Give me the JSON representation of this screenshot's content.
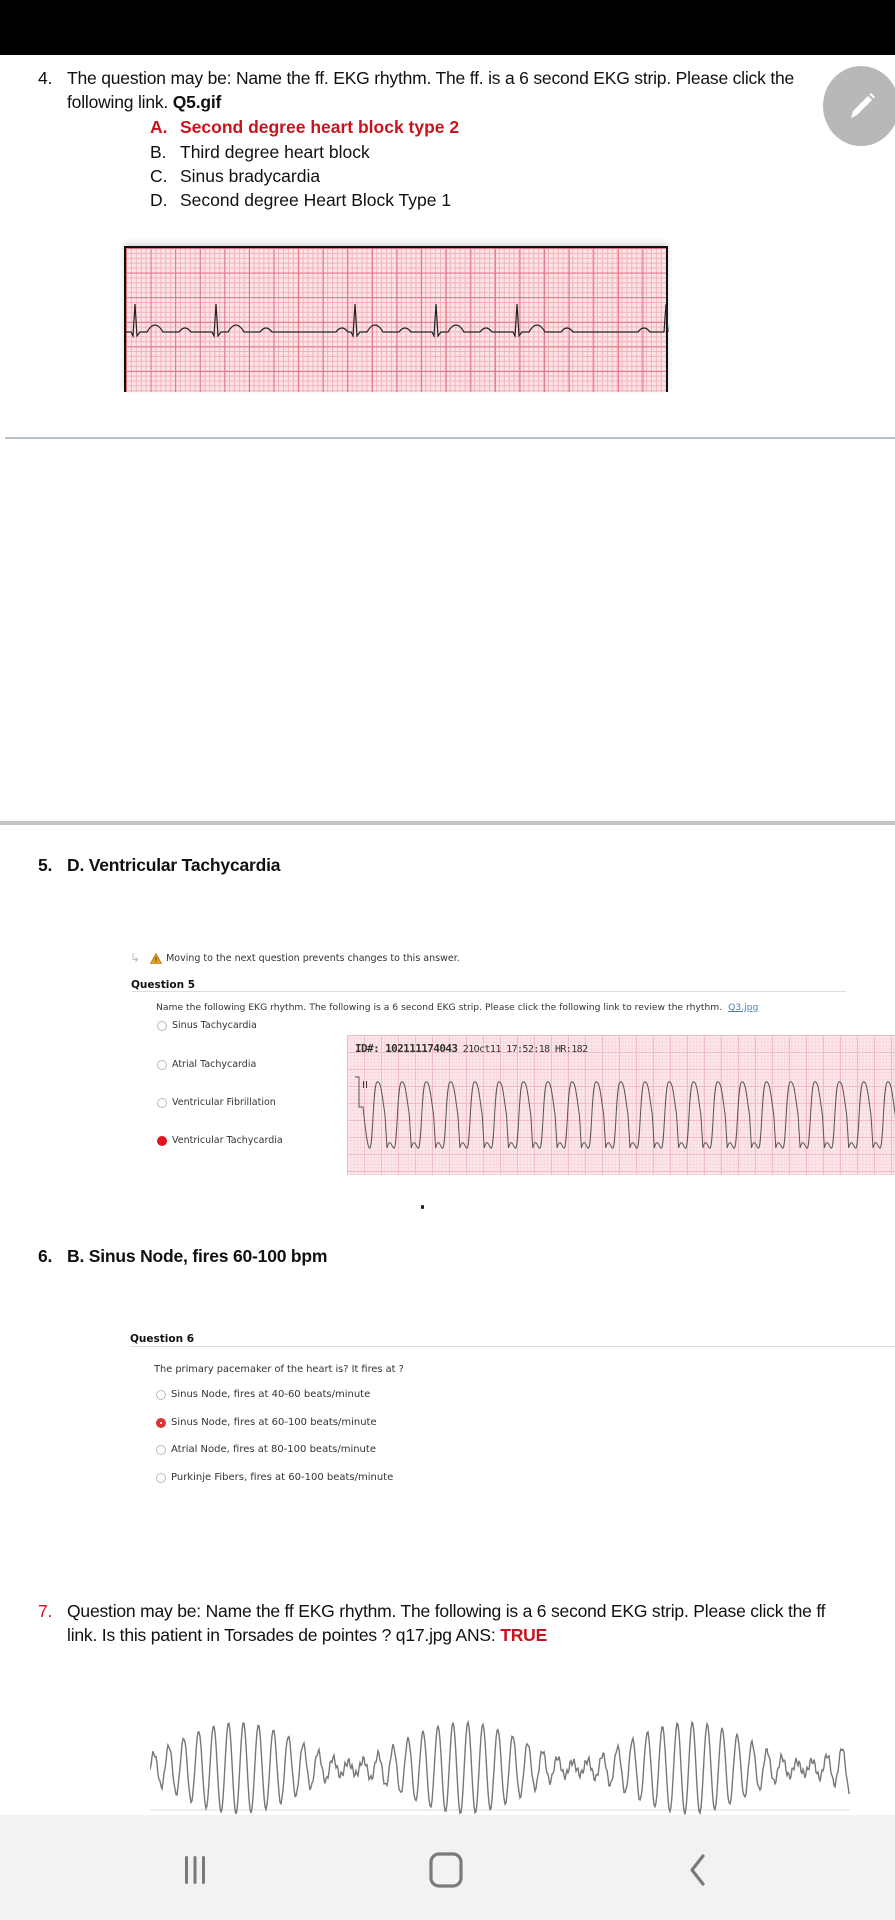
{
  "q4": {
    "number": "4.",
    "text_line1": "The question may be: Name the ff. EKG rhythm. The ff. is a 6 second EKG strip. Please click the",
    "text_line2_prefix": "following link. ",
    "link_file": "Q5.gif",
    "options": [
      {
        "letter": "A.",
        "label": "Second degree heart block type 2",
        "highlighted": true,
        "color": "#c8141c"
      },
      {
        "letter": "B.",
        "label": "Third degree heart block",
        "highlighted": false
      },
      {
        "letter": "C.",
        "label": "Sinus bradycardia",
        "highlighted": false
      },
      {
        "letter": "D.",
        "label": "Second degree Heart Block Type 1",
        "highlighted": false
      }
    ],
    "ekg_image": "second-degree-heart-block-strip"
  },
  "edit_button": {
    "icon": "pencil-icon",
    "color": "#b8b8b8"
  },
  "q5": {
    "number": "5.",
    "answer": "D. Ventricular Tachycardia",
    "screenshot": {
      "warning": "Moving to the next question prevents changes to this answer.",
      "title": "Question 5",
      "prompt": "Name the following EKG rhythm. The following is a 6 second EKG strip. Please click the following link to review the rhythm.",
      "link": "Q3.jpg",
      "choices": [
        {
          "label": "Sinus Tachycardia",
          "selected": false
        },
        {
          "label": "Atrial Tachycardia",
          "selected": false
        },
        {
          "label": "Ventricular Fibrillation",
          "selected": false
        },
        {
          "label": "Ventricular Tachycardia",
          "selected": true
        }
      ],
      "ekg_header_id": "ID#: 102111174043",
      "ekg_header_rest": " 21Oct11 17:52:18 HR:182",
      "lead_label": "II"
    }
  },
  "q6": {
    "number": "6.",
    "answer": "B. Sinus Node, fires 60-100 bpm",
    "screenshot": {
      "title": "Question 6",
      "prompt": "The primary pacemaker of the heart is? It fires at ?",
      "choices": [
        {
          "label": "Sinus Node, fires at 40-60 beats/minute",
          "selected": false
        },
        {
          "label": "Sinus Node, fires at 60-100 beats/minute",
          "selected": true
        },
        {
          "label": "Atrial Node, fires at 80-100 beats/minute",
          "selected": false
        },
        {
          "label": "Purkinje Fibers, fires at 60-100 beats/minute",
          "selected": false
        }
      ]
    }
  },
  "q7": {
    "number": "7.",
    "text_line1": "Question may be: Name the ff EKG rhythm. The following is a 6 second EKG strip. Please click the ff",
    "text_line2_prefix": "link. Is this patient in Torsades de pointes ? q17.jpg  ANS: ",
    "answer": "TRUE",
    "answer_color": "#c8141c",
    "ekg_image": "torsades-de-pointes-strip"
  },
  "nav_bar": {
    "buttons": [
      {
        "name": "recent-apps",
        "icon": "recent-apps-icon"
      },
      {
        "name": "home",
        "icon": "home-icon"
      },
      {
        "name": "back",
        "icon": "back-icon"
      }
    ]
  }
}
